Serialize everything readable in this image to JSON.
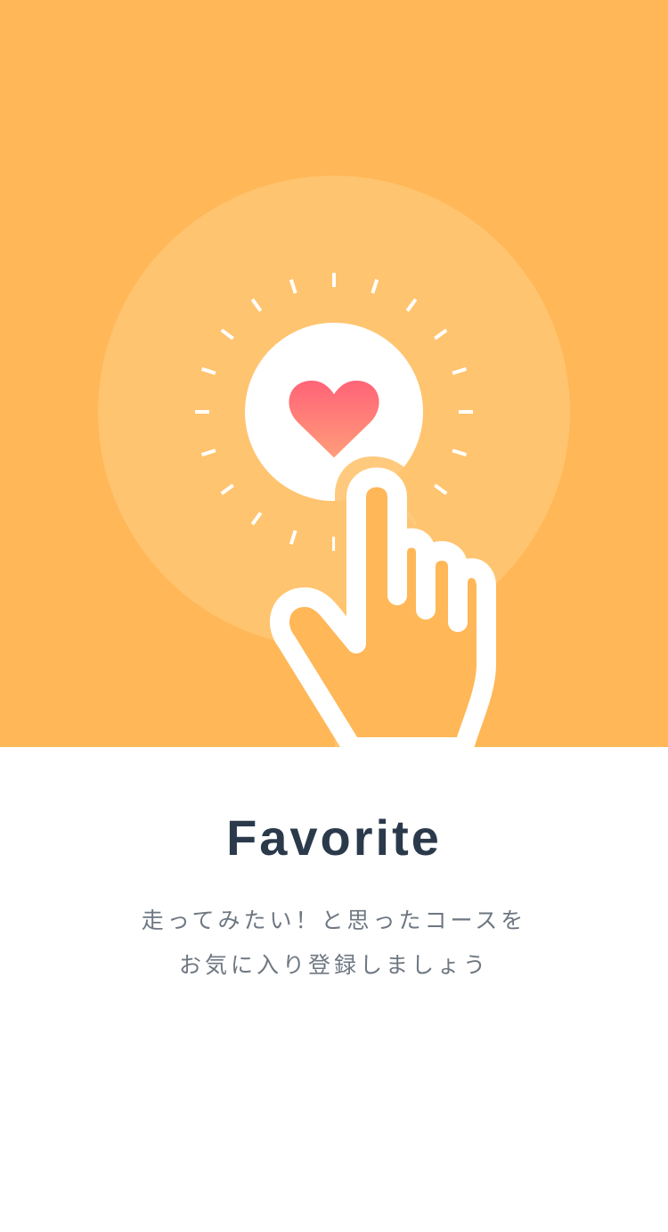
{
  "colors": {
    "hero_background": "#FFB757",
    "halo": "#FFC46F",
    "heart_top": "#FF6477",
    "heart_bottom": "#FF9C7A",
    "title": "#2B3A4B",
    "description": "#6E7782"
  },
  "hero": {
    "illustration": "hand-tapping-heart",
    "icons": [
      "heart-icon",
      "pointing-hand-icon"
    ]
  },
  "onboarding": {
    "title": "Favorite",
    "description_lines": [
      "走ってみたい！と思ったコースを",
      "お気に入り登録しましょう"
    ]
  }
}
